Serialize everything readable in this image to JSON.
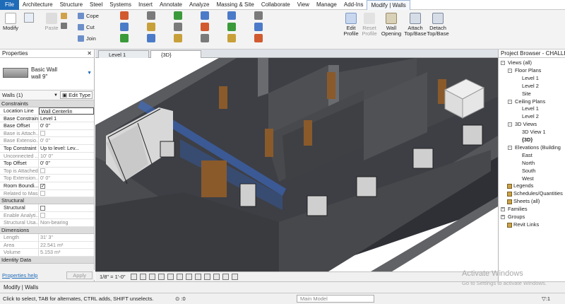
{
  "menus": [
    "File",
    "Architecture",
    "Structure",
    "Steel",
    "Systems",
    "Insert",
    "Annotate",
    "Analyze",
    "Massing & Site",
    "Collaborate",
    "View",
    "Manage",
    "Add-Ins",
    "Modify | Walls"
  ],
  "ribbon": {
    "modify": "Modify",
    "paste": "Paste",
    "cope": "Cope",
    "cut": "Cut",
    "join": "Join",
    "edit_profile": [
      "Edit",
      "Profile"
    ],
    "reset_profile": [
      "Reset",
      "Profile"
    ],
    "wall_opening": [
      "Wall",
      "Opening"
    ],
    "attach": [
      "Attach",
      "Top/Base"
    ],
    "detach": [
      "Detach",
      "Top/Base"
    ]
  },
  "properties": {
    "title": "Properties",
    "type_name": "Basic Wall",
    "type_sub": "wall 9\"",
    "selector": "Walls (1)",
    "edit_type": "Edit Type",
    "sections": [
      {
        "name": "Constraints",
        "rows": [
          {
            "k": "Location Line",
            "v": "Wall Centerlin",
            "box": true
          },
          {
            "k": "Base Constraint",
            "v": "Level 1"
          },
          {
            "k": "Base Offset",
            "v": "0'  0\""
          },
          {
            "k": "Base is Attach...",
            "v": "",
            "cb": false,
            "dim": true
          },
          {
            "k": "Base Extensio...",
            "v": "0'  0\"",
            "dim": true
          },
          {
            "k": "Top Constraint",
            "v": "Up to level: Lev..."
          },
          {
            "k": "Unconnected ...",
            "v": "10'  0\"",
            "dim": true
          },
          {
            "k": "Top Offset",
            "v": "0'  0\""
          },
          {
            "k": "Top is Attached",
            "v": "",
            "cb": false,
            "dim": true
          },
          {
            "k": "Top Extension...",
            "v": "0'  0\"",
            "dim": true
          },
          {
            "k": "Room Boundi...",
            "v": "",
            "cb": true
          },
          {
            "k": "Related to Mass",
            "v": "",
            "cb": false,
            "dim": true
          }
        ]
      },
      {
        "name": "Structural",
        "rows": [
          {
            "k": "Structural",
            "v": "",
            "cb": false
          },
          {
            "k": "Enable Analyti...",
            "v": "",
            "cb": false,
            "dim": true
          },
          {
            "k": "Structural Usa...",
            "v": "Non-bearing",
            "dim": true
          }
        ]
      },
      {
        "name": "Dimensions",
        "rows": [
          {
            "k": "Length",
            "v": "31'  3\"",
            "dim": true
          },
          {
            "k": "Area",
            "v": "22.541 m²",
            "dim": true
          },
          {
            "k": "Volume",
            "v": "5.153 m³",
            "dim": true
          }
        ]
      },
      {
        "name": "Identity Data",
        "rows": []
      }
    ],
    "help": "Properties help",
    "apply": "Apply"
  },
  "view_tabs": [
    "Level 1",
    "{3D}"
  ],
  "view_control": {
    "scale": "1/8\" = 1'-0\""
  },
  "browser": {
    "title": "Project Browser - CHALLENG",
    "items": [
      {
        "label": "Views (all)",
        "indent": 0,
        "pm": "-"
      },
      {
        "label": "Floor Plans",
        "indent": 1,
        "pm": "-"
      },
      {
        "label": "Level 1",
        "indent": 2
      },
      {
        "label": "Level 2",
        "indent": 2
      },
      {
        "label": "Site",
        "indent": 2
      },
      {
        "label": "Ceiling Plans",
        "indent": 1,
        "pm": "-"
      },
      {
        "label": "Level 1",
        "indent": 2
      },
      {
        "label": "Level 2",
        "indent": 2
      },
      {
        "label": "3D Views",
        "indent": 1,
        "pm": "-"
      },
      {
        "label": "3D View 1",
        "indent": 2
      },
      {
        "label": "{3D}",
        "indent": 2,
        "bold": true
      },
      {
        "label": "Elevations (Building",
        "indent": 1,
        "pm": "-"
      },
      {
        "label": "East",
        "indent": 2
      },
      {
        "label": "North",
        "indent": 2
      },
      {
        "label": "South",
        "indent": 2
      },
      {
        "label": "West",
        "indent": 2
      },
      {
        "label": "Legends",
        "indent": 0,
        "icon": true
      },
      {
        "label": "Schedules/Quantities",
        "indent": 0,
        "icon": true
      },
      {
        "label": "Sheets (all)",
        "indent": 0,
        "icon": true
      },
      {
        "label": "Families",
        "indent": 0,
        "pm": "+"
      },
      {
        "label": "Groups",
        "indent": 0,
        "pm": "+"
      },
      {
        "label": "Revit Links",
        "indent": 0,
        "icon": true
      }
    ]
  },
  "status": "Modify | Walls",
  "hint": "Click to select, TAB for alternates, CTRL adds, SHIFT unselects.",
  "model_dropdown": "Main Model",
  "hint_zero": ":0",
  "filter_count": ":1",
  "watermark": {
    "line1": "Activate Windows",
    "line2": "Go to Settings to activate Windows."
  },
  "colors": {
    "file_tab": "#1e6bb8",
    "selection": "#3b6fd6",
    "walls": "#4d4d4f",
    "floor": "#5a5e66"
  }
}
